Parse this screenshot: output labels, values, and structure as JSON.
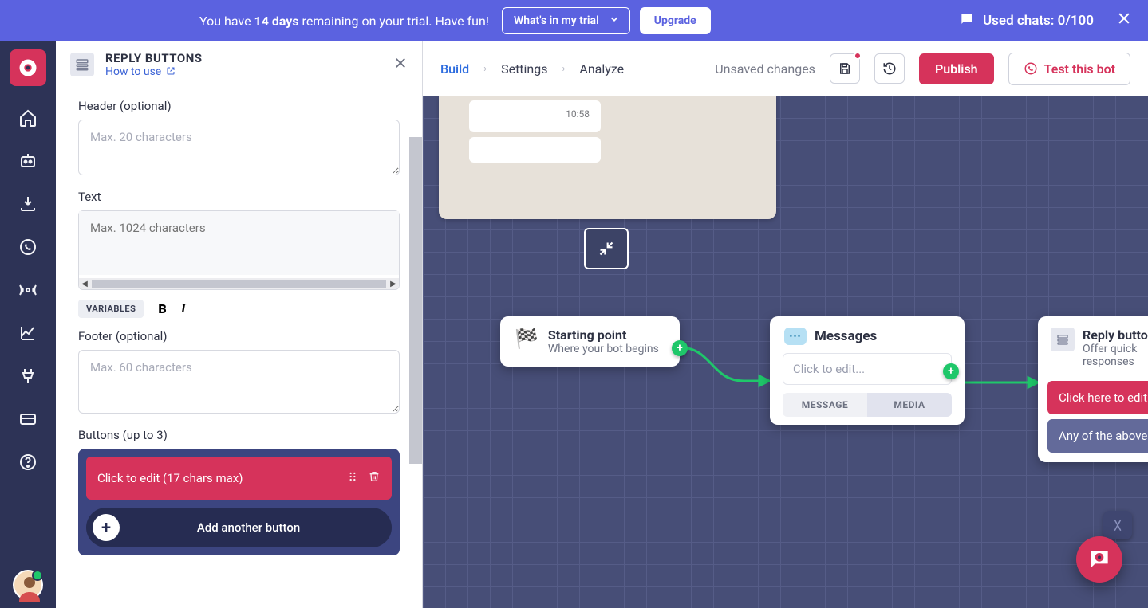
{
  "banner": {
    "trial_prefix": "You have ",
    "trial_days": "14 days",
    "trial_suffix": " remaining on your trial. Have fun!",
    "whats_in": "What's in my trial",
    "upgrade": "Upgrade",
    "used_chats_label": "Used chats: ",
    "used_chats_value": "0/100"
  },
  "sidepanel": {
    "title": "REPLY BUTTONS",
    "how_to_use": "How to use",
    "header_label": "Header (optional)",
    "header_placeholder": "Max. 20 characters",
    "text_label": "Text",
    "text_placeholder": "Max. 1024 characters",
    "variables": "VARIABLES",
    "footer_label": "Footer (optional)",
    "footer_placeholder": "Max. 60 characters",
    "buttons_label": "Buttons (up to 3)",
    "button_row_text": "Click to edit (17 chars max)",
    "add_another": "Add another button"
  },
  "topbar": {
    "tabs": {
      "build": "Build",
      "settings": "Settings",
      "analyze": "Analyze"
    },
    "unsaved": "Unsaved changes",
    "publish": "Publish",
    "test": "Test this bot"
  },
  "preview": {
    "time": "10:58"
  },
  "nodes": {
    "start": {
      "title": "Starting point",
      "sub": "Where your bot begins"
    },
    "messages": {
      "title": "Messages",
      "click_to_edit": "Click to edit...",
      "tab_message": "MESSAGE",
      "tab_media": "MEDIA"
    },
    "reply": {
      "title": "Reply buttons",
      "sub": "Offer quick responses",
      "pill1": "Click here to edit",
      "pill2": "Any of the above"
    }
  }
}
